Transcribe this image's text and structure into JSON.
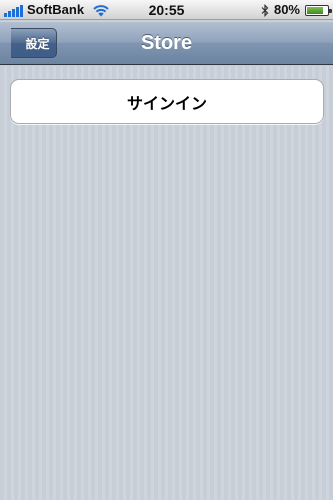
{
  "status_bar": {
    "carrier": "SoftBank",
    "time": "20:55",
    "battery_percent_label": "80%",
    "battery_level": 0.8
  },
  "nav_bar": {
    "title": "Store",
    "back_label": "設定"
  },
  "main": {
    "sign_in_label": "サインイン"
  },
  "colors": {
    "nav_bar": "#7f95b1",
    "background": "#c7ced7",
    "signal_bars": "#1f6fd6"
  }
}
